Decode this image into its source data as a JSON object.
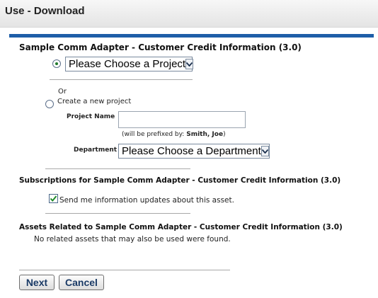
{
  "window": {
    "title": "Use - Download"
  },
  "section_project": {
    "heading": "Sample Comm Adapter - Customer Credit Information (3.0)",
    "project_select": {
      "value": "Please Choose a Project",
      "selected": true
    },
    "or_label": "Or",
    "create_label": "Create a new project",
    "project_name_label": "Project Name",
    "project_name_value": "",
    "prefix_note_prefix": "(will be prefixed by:",
    "prefix_note_name": "Smith, Joe",
    "prefix_note_suffix": ")",
    "department_label": "Department",
    "department_select": {
      "value": "Please Choose a Department"
    }
  },
  "section_subscriptions": {
    "heading": "Subscriptions for Sample Comm Adapter - Customer Credit Information (3.0)",
    "checkbox_label": "Send me information updates about this asset.",
    "checked": true
  },
  "section_related": {
    "heading": "Assets Related to Sample Comm Adapter - Customer Credit Information (3.0)",
    "message": "No related assets that may also be used were found."
  },
  "buttons": {
    "next": "Next",
    "cancel": "Cancel"
  },
  "colors": {
    "accent_bar": "#1e5ea8",
    "button_text": "#1a3a66"
  }
}
